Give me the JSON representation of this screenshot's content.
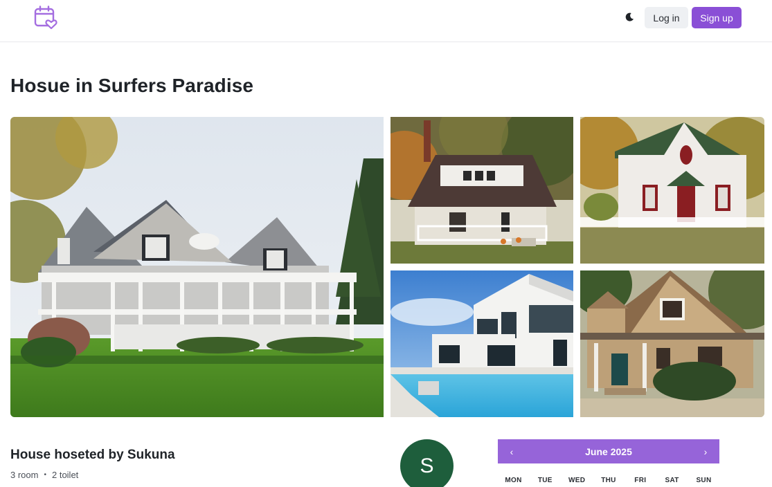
{
  "header": {
    "logo_icon": "calendar-heart-icon",
    "theme_icon": "moon-icon",
    "login_label": "Log in",
    "signup_label": "Sign up",
    "accent": "#8a4fd6"
  },
  "listing": {
    "title": "Hosue in Surfers Paradise",
    "photos": [
      {
        "name": "main-house-photo",
        "desc": "grey shingle house with white porch and lawn"
      },
      {
        "name": "brown-roof-house-photo",
        "desc": "brown roof bungalow with white porch"
      },
      {
        "name": "white-cottage-photo",
        "desc": "white cottage with red trim"
      },
      {
        "name": "modern-pool-house-photo",
        "desc": "modern white house with pool"
      },
      {
        "name": "craftsman-house-photo",
        "desc": "tan craftsman house"
      }
    ]
  },
  "host": {
    "title": "House hoseted by Sukuna",
    "rooms": "3 room",
    "separator": "•",
    "toilets": "2 toilet",
    "avatar_initial": "S",
    "avatar_color": "#1e5e3c"
  },
  "calendar": {
    "prev": "‹",
    "next": "›",
    "month": "June 2025",
    "header_color": "#9664d9",
    "weekdays": [
      "MON",
      "TUE",
      "WED",
      "THU",
      "FRI",
      "SAT",
      "SUN"
    ]
  }
}
